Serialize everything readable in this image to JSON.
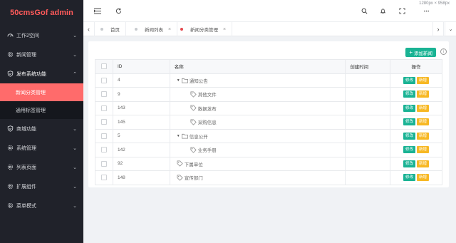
{
  "brand": "50cmsGof admin",
  "sidebar": {
    "items": [
      {
        "label": "工作2空间",
        "icon": "dashboard-icon"
      },
      {
        "label": "新闻管理",
        "icon": "gear-icon"
      },
      {
        "label": "发布系统功能",
        "icon": "shield-icon",
        "open": true,
        "children": [
          {
            "label": "新闻分类管理",
            "active": true
          },
          {
            "label": "通用标签管理",
            "active": false
          }
        ]
      },
      {
        "label": "商城功能",
        "icon": "shield-icon"
      },
      {
        "label": "系统管理",
        "icon": "gear-icon"
      },
      {
        "label": "列表页面",
        "icon": "gear-icon"
      },
      {
        "label": "扩展组件",
        "icon": "gear-icon"
      },
      {
        "label": "菜单模式",
        "icon": "gear-icon"
      }
    ]
  },
  "topbar": {
    "dims": "1280px × 958px"
  },
  "tabs": [
    {
      "label": "首页",
      "closable": false,
      "active": false
    },
    {
      "label": "新闻列表",
      "closable": true,
      "active": false
    },
    {
      "label": "新闻分类管理",
      "closable": true,
      "active": true
    }
  ],
  "toolbar": {
    "add_label": "添加新闻",
    "info": "i"
  },
  "table": {
    "headers": {
      "id": "ID",
      "name": "名称",
      "time": "创建时间",
      "op": "操作"
    },
    "op_edit": "修改",
    "op_add": "新增",
    "rows": [
      {
        "id": "4",
        "name": "通知公告",
        "level": 0,
        "type": "folder",
        "time": ""
      },
      {
        "id": "9",
        "name": "其他文件",
        "level": 1,
        "type": "tag",
        "time": ""
      },
      {
        "id": "143",
        "name": "数据发布",
        "level": 1,
        "type": "tag",
        "time": ""
      },
      {
        "id": "145",
        "name": "采购信息",
        "level": 1,
        "type": "tag",
        "time": ""
      },
      {
        "id": "5",
        "name": "信息公开",
        "level": 0,
        "type": "folder",
        "time": ""
      },
      {
        "id": "142",
        "name": "业务手册",
        "level": 1,
        "type": "tag",
        "time": ""
      },
      {
        "id": "92",
        "name": "下属单位",
        "level": 0,
        "type": "tag",
        "time": ""
      },
      {
        "id": "148",
        "name": "宣传部门",
        "level": 0,
        "type": "tag",
        "time": ""
      }
    ]
  },
  "colors": {
    "accent": "#ff6b6b",
    "sidebar": "#20222a",
    "edit": "#1ab394",
    "add": "#f7b824"
  }
}
